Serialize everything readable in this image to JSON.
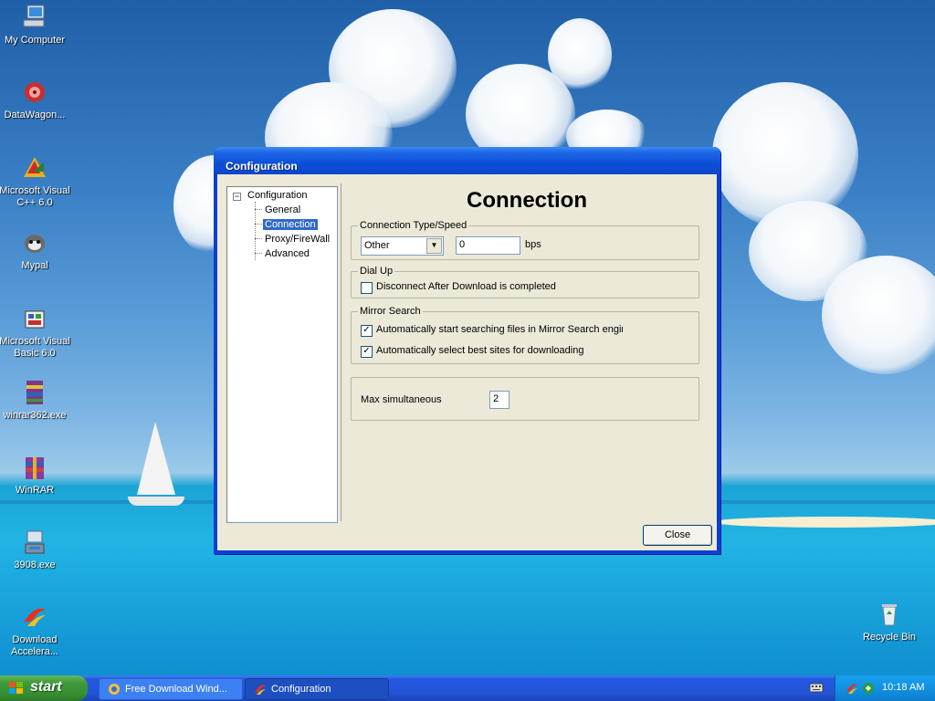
{
  "desktop": {
    "icons": [
      {
        "label": "My Computer"
      },
      {
        "label": "DataWagon..."
      },
      {
        "label": "Microsoft Visual C++ 6.0"
      },
      {
        "label": "Mypal"
      },
      {
        "label": "Microsoft Visual Basic 6.0"
      },
      {
        "label": "winrar362.exe"
      },
      {
        "label": "WinRAR"
      },
      {
        "label": "3908.exe"
      },
      {
        "label": "Download Accelera..."
      },
      {
        "label": "Recycle Bin"
      }
    ]
  },
  "dialog": {
    "title": "Configuration",
    "tree": {
      "root": "Configuration",
      "children": [
        "General",
        "Connection",
        "Proxy/FireWall",
        "Advanced"
      ],
      "selected": "Connection"
    },
    "panel_title": "Connection",
    "connection_type": {
      "legend": "Connection Type/Speed",
      "type_value": "Other",
      "speed_value": "0",
      "unit": "bps"
    },
    "dial_up": {
      "legend": "Dial Up",
      "disconnect_label": "Disconnect After Download is completed",
      "disconnect_checked": false
    },
    "mirror_search": {
      "legend": "Mirror Search",
      "auto_search_label": "Automatically start searching files in Mirror Search engines",
      "auto_search_checked": true,
      "auto_select_label": "Automatically select best sites for downloading",
      "auto_select_checked": true
    },
    "max_simultaneous": {
      "label": "Max simultaneous",
      "value": "2"
    },
    "close_label": "Close"
  },
  "taskbar": {
    "start_label": "start",
    "tasks": [
      {
        "label": "Free Download Wind...",
        "active": false
      },
      {
        "label": "Configuration",
        "active": true
      }
    ],
    "clock": "10:18 AM"
  }
}
